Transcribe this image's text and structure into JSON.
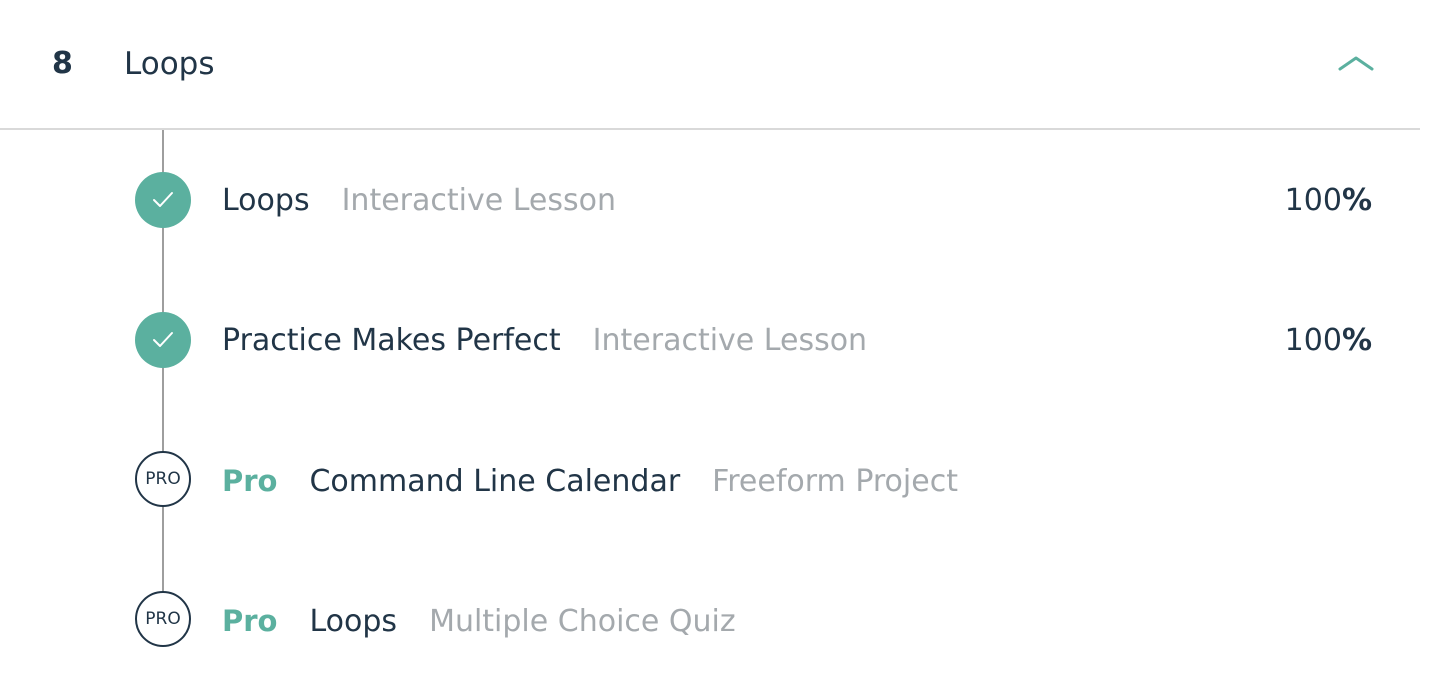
{
  "module": {
    "number": "8",
    "title": "Loops",
    "collapse_icon": "chevron-up-icon",
    "accent_color": "#5bb09f",
    "text_color": "#213547",
    "muted_color": "#a4a9ad"
  },
  "items": [
    {
      "status": "completed",
      "status_icon": "check-icon",
      "title": "Loops",
      "type": "Interactive Lesson",
      "progress_number": "100",
      "progress_symbol": "%"
    },
    {
      "status": "completed",
      "status_icon": "check-icon",
      "title": "Practice Makes Perfect",
      "type": "Interactive Lesson",
      "progress_number": "100",
      "progress_symbol": "%"
    },
    {
      "status": "pro",
      "badge_label": "PRO",
      "pro_label": "Pro",
      "title": "Command Line Calendar",
      "type": "Freeform Project"
    },
    {
      "status": "pro",
      "badge_label": "PRO",
      "pro_label": "Pro",
      "title": "Loops",
      "type": "Multiple Choice Quiz"
    }
  ]
}
